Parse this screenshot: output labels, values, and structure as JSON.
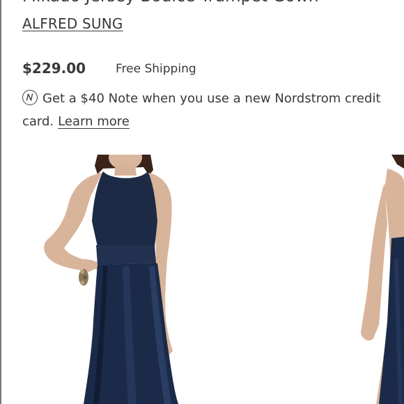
{
  "product": {
    "title": "Mikado Jersey Bodice Trumpet Gown",
    "brand": "ALFRED SUNG",
    "price": "$229.00",
    "shipping": "Free Shipping"
  },
  "promo": {
    "icon": "nordstrom-n-icon",
    "text": "Get a $40 Note when you use a new Nordstrom credit card.",
    "link_label": "Learn more"
  },
  "gallery": {
    "main_image": "navy trumpet gown front view",
    "next_image": "navy trumpet gown side view"
  },
  "colors": {
    "text": "#393939",
    "gown_navy": "#1c2a45",
    "background": "#ffffff"
  }
}
